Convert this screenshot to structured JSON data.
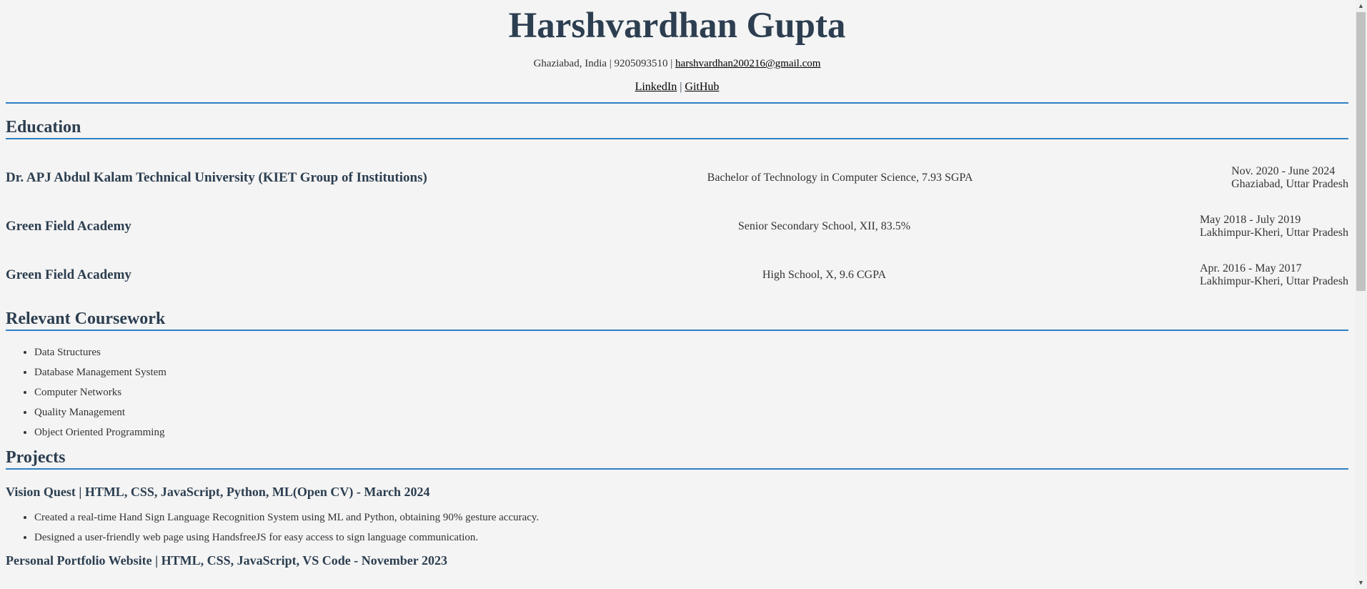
{
  "header": {
    "name": "Harshvardhan Gupta",
    "contact_prefix": "Ghaziabad, India | 9205093510 | ",
    "email": "harshvardhan200216@gmail.com",
    "linkedin": "LinkedIn",
    "separator": " | ",
    "github": "GitHub"
  },
  "education": {
    "title": "Education",
    "entries": [
      {
        "institution": "Dr. APJ Abdul Kalam Technical University (KIET Group of Institutions)",
        "degree": "Bachelor of Technology in Computer Science, 7.93 SGPA",
        "dates": "Nov. 2020 - June 2024",
        "location": "Ghaziabad, Uttar Pradesh"
      },
      {
        "institution": "Green Field Academy",
        "degree": "Senior Secondary School, XII, 83.5%",
        "dates": "May 2018 - July 2019",
        "location": "Lakhimpur-Kheri, Uttar Pradesh"
      },
      {
        "institution": "Green Field Academy",
        "degree": "High School, X, 9.6 CGPA",
        "dates": "Apr. 2016 - May 2017",
        "location": "Lakhimpur-Kheri, Uttar Pradesh"
      }
    ]
  },
  "coursework": {
    "title": "Relevant Coursework",
    "items": [
      "Data Structures",
      "Database Management System",
      "Computer Networks",
      "Quality Management",
      "Object Oriented Programming"
    ]
  },
  "projects": {
    "title": "Projects",
    "entries": [
      {
        "title": "Vision Quest | HTML, CSS, JavaScript, Python, ML(Open CV) - March 2024",
        "bullets": [
          "Created a real-time Hand Sign Language Recognition System using ML and Python, obtaining 90% gesture accuracy.",
          "Designed a user-friendly web page using HandsfreeJS for easy access to sign language communication."
        ]
      },
      {
        "title": "Personal Portfolio Website | HTML, CSS, JavaScript, VS Code - November 2023",
        "bullets": []
      }
    ]
  },
  "colors": {
    "accent": "#2f80c4",
    "heading": "#2c3e50",
    "background": "#f4f4f4"
  }
}
